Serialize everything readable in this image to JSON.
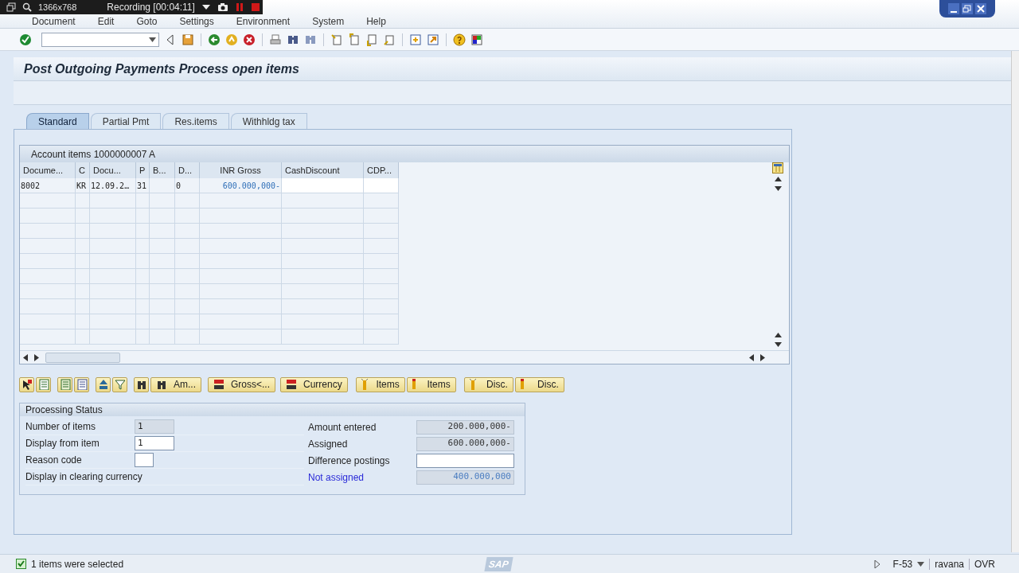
{
  "recorder": {
    "resolution": "1366x768",
    "status": "Recording [00:04:11]"
  },
  "menu": [
    "Document",
    "Edit",
    "Goto",
    "Settings",
    "Environment",
    "System",
    "Help"
  ],
  "title": "Post Outgoing Payments Process open items",
  "tabs": [
    {
      "label": "Standard",
      "selected": true
    },
    {
      "label": "Partial Pmt",
      "selected": false
    },
    {
      "label": "Res.items",
      "selected": false
    },
    {
      "label": "Withhldg tax",
      "selected": false
    }
  ],
  "table": {
    "title": "Account items 1000000007 A",
    "columns": [
      {
        "label": "Docume...",
        "kind": "text"
      },
      {
        "label": "C",
        "kind": "text"
      },
      {
        "label": "Docu...",
        "kind": "text"
      },
      {
        "label": "P",
        "kind": "text"
      },
      {
        "label": "B...",
        "kind": "text"
      },
      {
        "label": "D...",
        "kind": "text"
      },
      {
        "label": "INR Gross",
        "kind": "amount"
      },
      {
        "label": "CashDiscount",
        "kind": "input"
      },
      {
        "label": "CDP...",
        "kind": "input"
      }
    ],
    "rows": [
      [
        "8002",
        "KR",
        "12.09.2…",
        "31",
        null,
        "0",
        "600.000,000-",
        null,
        null
      ]
    ]
  },
  "table_buttons": [
    {
      "kind": "icon"
    },
    {
      "kind": "icon"
    },
    {
      "kind": "icon"
    },
    {
      "kind": "icon"
    },
    {
      "kind": "icon"
    },
    {
      "kind": "icon"
    },
    {
      "kind": "icon"
    },
    {
      "kind": "labeled",
      "label": "Am..."
    },
    {
      "kind": "labeled",
      "label": "Gross<..."
    },
    {
      "kind": "labeled",
      "label": "Currency"
    },
    {
      "kind": "labeled",
      "label": "Items"
    },
    {
      "kind": "labeled",
      "label": "Items"
    },
    {
      "kind": "labeled",
      "label": "Disc."
    },
    {
      "kind": "labeled",
      "label": "Disc."
    }
  ],
  "processing_status": {
    "title": "Processing Status",
    "left": [
      {
        "label": "Number of items",
        "value": "1",
        "editable": false,
        "kind": "field"
      },
      {
        "label": "Display from item",
        "value": "1",
        "editable": true,
        "kind": "field"
      },
      {
        "label": "Reason code",
        "editable": true,
        "kind": "short"
      },
      {
        "label": "Display in clearing currency",
        "kind": "label"
      }
    ],
    "right": [
      {
        "label": "Amount entered",
        "value": "200.000,000-",
        "editable": false,
        "highlight": false
      },
      {
        "label": "Assigned",
        "value": "600.000,000-",
        "editable": false,
        "highlight": false
      },
      {
        "label": "Difference postings",
        "editable": true,
        "highlight": false
      },
      {
        "label": "Not assigned",
        "value": "400.000,000",
        "editable": false,
        "highlight": true
      }
    ]
  },
  "status_bar": {
    "message": "1 items were selected",
    "logo": "SAP",
    "transaction": "F-53",
    "user": "ravana",
    "mode": "OVR"
  }
}
